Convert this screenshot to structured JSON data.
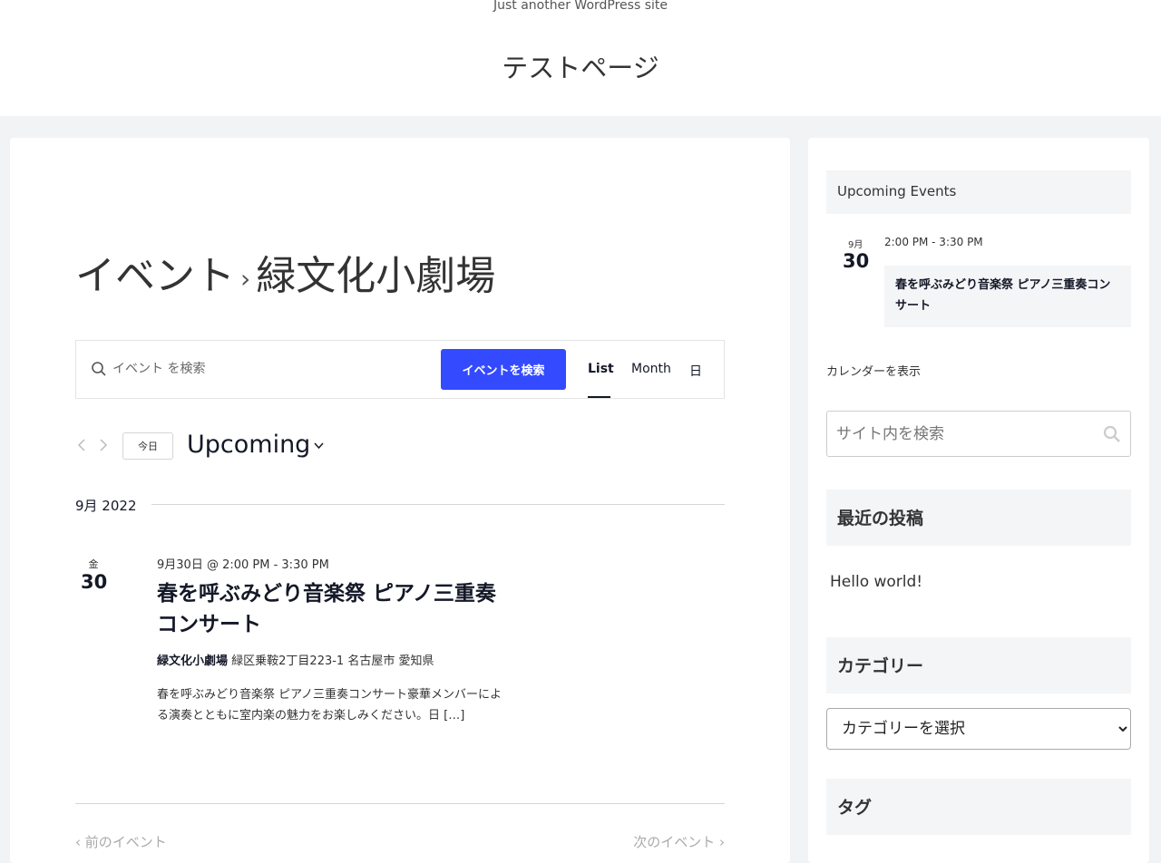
{
  "header": {
    "tagline": "Just another WordPress site",
    "site_title": "テストページ"
  },
  "main": {
    "heading_parent": "イベント",
    "heading_separator": "›",
    "heading_current": "緑文化小劇場",
    "search": {
      "placeholder": "イベント を検索",
      "button_label": "イベントを検索"
    },
    "views": [
      "List",
      "Month",
      "日"
    ],
    "active_view": "List",
    "today_label": "今日",
    "upcoming_label": "Upcoming",
    "month_label": "9月 2022",
    "event": {
      "day_of_week": "金",
      "day": "30",
      "datetime": "9月30日 @ 2:00 PM - 3:30 PM",
      "title": "春を呼ぶみどり音楽祭 ピアノ三重奏コンサート",
      "venue_name": "緑文化小劇場",
      "venue_address": "緑区乗鞍2丁目223-1 名古屋市 愛知県",
      "description": "春を呼ぶみどり音楽祭 ピアノ三重奏コンサート豪華メンバーによる演奏とともに室内楽の魅力をお楽しみください。日 […]"
    },
    "prev_label": "前のイベント",
    "next_label": "次のイベント"
  },
  "sidebar": {
    "upcoming_title": "Upcoming Events",
    "event": {
      "month": "9月",
      "day": "30",
      "time": "2:00 PM - 3:30 PM",
      "title": "春を呼ぶみどり音楽祭 ピアノ三重奏コンサート"
    },
    "calendar_link": "カレンダーを表示",
    "search_placeholder": "サイト内を検索",
    "recent_posts_title": "最近の投稿",
    "recent_post": "Hello world!",
    "categories_title": "カテゴリー",
    "category_select": "カテゴリーを選択",
    "tags_title": "タグ"
  }
}
